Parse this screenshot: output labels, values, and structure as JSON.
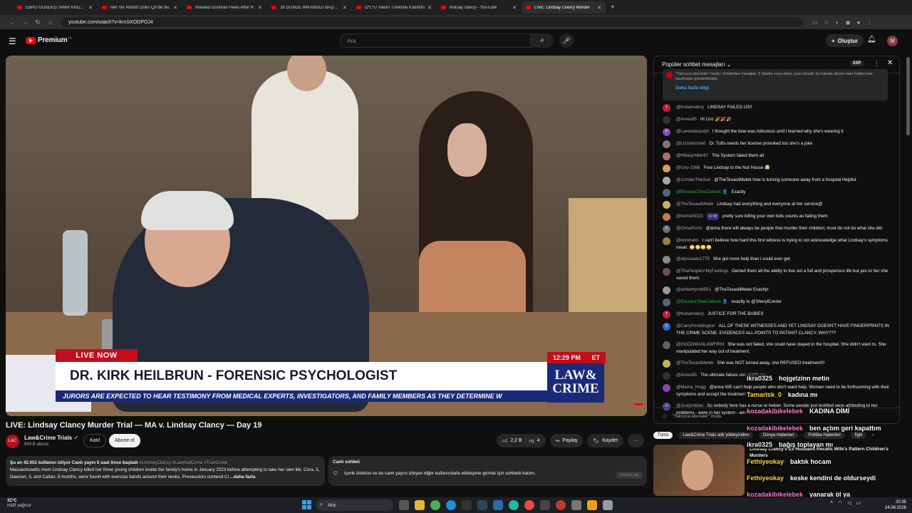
{
  "browser": {
    "tabs": [
      {
        "label": "EBRU GÜNDEŞ SİNİR KRİZİ GEÇ",
        "active": false
      },
      {
        "label": "Her Yer Robot! Dolu! Çin'de Bu",
        "active": false
      },
      {
        "label": "Masked Gunman Flees After R",
        "active": false
      },
      {
        "label": "38 GÜNDE İMKANSIZI BAŞARA",
        "active": false
      },
      {
        "label": "Ö*L*Ü Yakını Törenine Katıldım",
        "active": false
      },
      {
        "label": "lindsay clancy - YouTube",
        "active": false
      },
      {
        "label": "LIVE: Lindsay Clancy Murder",
        "active": true
      }
    ],
    "url": "youtube.com/watch?v=krnSXODPOJ4"
  },
  "header": {
    "logo_text": "Premium",
    "logo_sup": "TR",
    "search_placeholder": "Ara",
    "create_label": "Oluştur",
    "avatar_letter": "M"
  },
  "video": {
    "overlay": {
      "live_now": "LIVE NOW",
      "time": "12:29 PM",
      "tz": "ET",
      "name_strap": "DR. KIRK HEILBRUN - FORENSIC PSYCHOLOGIST",
      "ticker": "JURORS ARE EXPECTED TO HEAR TESTIMONY FROM MEDICAL EXPERTS, INVESTIGATORS, AND FAMILY MEMBERS AS THEY DETERMINE W",
      "brand_line1": "LAW&",
      "brand_line2": "CRIME"
    },
    "title": "LIVE: Lindsay Clancy Murder Trial — MA v. Lindsay Clancy — Day 19",
    "channel": {
      "name": "Law&Crime Trials",
      "subs": "949 B abone",
      "join": "Katıl",
      "subscribe": "Abone ol"
    },
    "actions": {
      "likes": "2,2 B",
      "dislikes": "4",
      "share": "Paylaş",
      "save": "Kaydet"
    },
    "description": {
      "stats": "Şu an 42.051 kullanıcı izliyor  Canlı yayın 5 saat önce başladı",
      "tags": "#LindsayClancy #LawAndCrime #TrueCrime",
      "text": "Massachusetts mom Lindsay Clancy killed her three young children inside the family's home in January 2023 before attempting to take her own life. Cora, 5, Dawson, 3, and Callan, 8 months, were found with exercise bands around their necks. Prosecutors contend Cl",
      "more": "...daha fazla"
    },
    "live_chat_box": {
      "title": "Canlı sohbet",
      "text": "İçerik üreticisi ve bu canlı yayını izleyen diğer kullanıcılarla etkileşime girmek için sohbete katılın.",
      "button": "Rehber ağ"
    }
  },
  "chat": {
    "header_title": "Popüler sohbet mesajları",
    "xp_label": "0XP",
    "notice_text": "\"Yalnızca aboneler\" modu: Gösterilen mesajlar, 5 dakika veya daha uzun süredir bu kanala abone olan kullanıcılar tarafından gönderilmiştir.",
    "notice_link": "Daha fazla bilgi",
    "messages": [
      {
        "author": "@trubamaboy",
        "text": "LINDSAY FAILED US!!",
        "color": "#c41e3a",
        "initial": "T",
        "member": false,
        "badge": ""
      },
      {
        "author": "@Ames85",
        "text": "Hi Linz 🎉🎉🎉",
        "color": "#333333",
        "initial": "",
        "member": false,
        "badge": ""
      },
      {
        "author": "@Lavenderpurpl",
        "text": "I thought the bow was ridiculous until I learned why she's wearing it",
        "color": "#8e44ad",
        "initial": "P",
        "member": false,
        "badge": ""
      },
      {
        "author": "@Lizziebizzie0",
        "text": "Dr. Tufts needs her license provoked too she's a joke",
        "color": "#7a7a7a",
        "initial": "",
        "member": false,
        "badge": ""
      },
      {
        "author": "@Hillarymiller97",
        "text": "The System failed them all",
        "color": "#b07070",
        "initial": "",
        "member": false,
        "badge": ""
      },
      {
        "author": "@Uno-1968",
        "text": "Free Lindsay to the Nut House 🤯",
        "color": "#d4a060",
        "initial": "",
        "member": false,
        "badge": ""
      },
      {
        "author": "@1UnderTheSun",
        "text": "@TheTexasliMelek how is turning someone away from a hospital Helpful.",
        "color": "#aaaaaa",
        "initial": "",
        "member": false,
        "badge": ""
      },
      {
        "author": "@Elevator2theGallows 👤",
        "text": "Exactly",
        "color": "#556677",
        "initial": "",
        "member": true,
        "badge": ""
      },
      {
        "author": "@TheTexasliMelek",
        "text": "Lindsay had everything and everyone at her service@",
        "color": "#c8b060",
        "initial": "",
        "member": false,
        "badge": ""
      },
      {
        "author": "@homer5023",
        "text": "pretty sure killing your own kids counts as failing them",
        "color": "#c08050",
        "initial": "",
        "member": false,
        "badge": "♔ #3"
      },
      {
        "author": "@OnnaXoXo",
        "text": "@anna there will always be people that murder their children; most do not do what she did.",
        "color": "#6a6a6a",
        "initial": "O",
        "member": false,
        "badge": ""
      },
      {
        "author": "@mimhahn",
        "text": "I can't believe how hard this first witness is trying to not acknowledge what Lindsay's symptoms mean. 🙄🙄🙄🙄",
        "color": "#a08040",
        "initial": "",
        "member": false,
        "badge": ""
      },
      {
        "author": "@alyrosado1775",
        "text": "She got more help than i could ever get",
        "color": "#888888",
        "initial": "",
        "member": false,
        "badge": ""
      },
      {
        "author": "@ThePeopleV.MyFeelings",
        "text": "Denied them all the ability to live out a full and prosperous life but yes to her she saved them.",
        "color": "#705050",
        "initial": "",
        "member": false,
        "badge": ""
      },
      {
        "author": "@amberlynn8591",
        "text": "@TheTexasliMelek Exactly!",
        "color": "#9a9a9a",
        "initial": "",
        "member": false,
        "badge": ""
      },
      {
        "author": "@Elevator2theGallows 👤",
        "text": "exactly to @SherylCorder",
        "color": "#556677",
        "initial": "",
        "member": true,
        "badge": ""
      },
      {
        "author": "@trubamaboy",
        "text": "JUSTICE FOR THE BABIES",
        "color": "#c41e3a",
        "initial": "T",
        "member": false,
        "badge": ""
      },
      {
        "author": "@CarryFerddington",
        "text": "ALL OF THESE WITNESSES AND YET LINDSAY DOESN'T HAVE FINGERPRINTS IN THE CRIME SCENE. EVIDENCES ALL POINTS TO PATSHIT CLANCY. WHY???",
        "color": "#2a6ad0",
        "initial": "C",
        "member": false,
        "badge": ""
      },
      {
        "author": "@GOODMANLAWFIRM",
        "text": "She was not failed, she could have stayed in the hospital. She didn't want to. She manipulated her way out of treatment.",
        "color": "#606060",
        "initial": "",
        "member": false,
        "badge": ""
      },
      {
        "author": "@TheTexasliMelek",
        "text": "She was NOT turned away, she REFUSED treatment!!!",
        "color": "#c8b060",
        "initial": "",
        "member": false,
        "badge": ""
      },
      {
        "author": "@Ames85",
        "text": "The ultimate failure one might say",
        "color": "#333333",
        "initial": "",
        "member": false,
        "badge": ""
      },
      {
        "author": "@Mama_Hogg",
        "text": "@anna WE can't help people who don't want help. Women need to be forthcoming with their symptoms and accept the treatment they're getting.",
        "color": "#8e44ad",
        "initial": "",
        "member": false,
        "badge": ""
      },
      {
        "author": "@Justjorddan",
        "text": "So nobody here has a nurse or helper. Some people just testified were attributing to her problems - were in her system - and in Patrick's truck",
        "color": "#5050a0",
        "initial": "J",
        "member": false,
        "badge": ""
      }
    ],
    "footer_text": "\"Yalnızca aboneler\" modu"
  },
  "recommendations": {
    "chips": [
      {
        "label": "Tümü",
        "active": true
      },
      {
        "label": "Law&Crime Trials adlı yükleyiciden",
        "active": false
      },
      {
        "label": "Dünya Haberleri",
        "active": false
      },
      {
        "label": "Politika Haberleri",
        "active": false
      },
      {
        "label": "İlgili",
        "active": false
      }
    ],
    "item_title": "Lindsay Clancy's Ex Husband Recalls Wife's Pattern Children's Murders",
    "item_channel": "Law&Crime Trials"
  },
  "overlay_chat": [
    {
      "user": "ikra0325",
      "msg": "hojgelzinn metin",
      "user_color": "#f2f2f2"
    },
    {
      "user": "Tamarisk_0",
      "msg": "kadına mı",
      "user_color": "#ffd24a"
    },
    {
      "user": "kozadakibikelebek",
      "msg": "KADINA DİMİ",
      "user_color": "#ff7bd4"
    },
    {
      "user": "kozadakibikelebek",
      "msg": "ben açtım geri kapattım",
      "user_color": "#ff7bd4"
    },
    {
      "user": "ikra0325",
      "msg": "bağış toplayan mı",
      "user_color": "#f2f2f2"
    },
    {
      "user": "Fethiyeokay",
      "msg": "baktık hocam",
      "user_color": "#ffd24a"
    },
    {
      "user": "Fethiyeokay",
      "msg": "keske kendini de oldurseydi",
      "user_color": "#ffd24a"
    },
    {
      "user": "kozadakibikelebek",
      "msg": "yanarak öl ya",
      "user_color": "#ff7bd4"
    }
  ],
  "taskbar": {
    "weather_temp": "31°C",
    "weather_desc": "Hafif yağmur",
    "search_label": "Ara",
    "time": "20:35",
    "date": "24.08.2026"
  }
}
